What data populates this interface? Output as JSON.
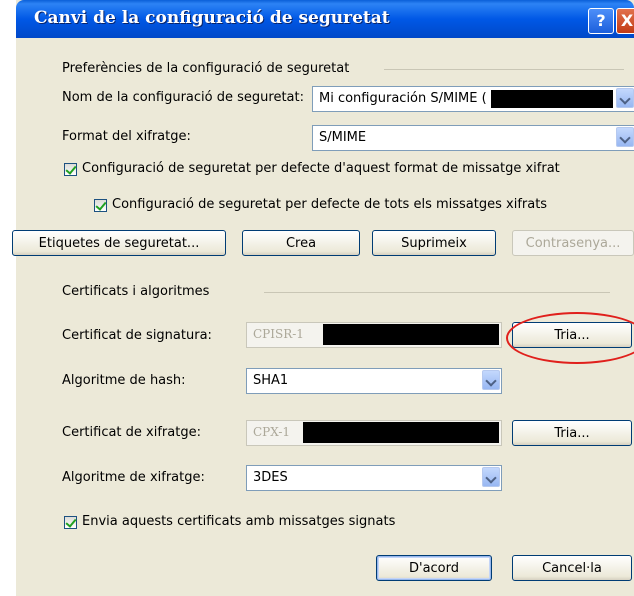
{
  "window": {
    "title": "Canvi de la configuració de seguretat",
    "help_label": "?",
    "close_label": "X"
  },
  "preferences": {
    "group_label": "Preferències de la configuració de seguretat",
    "name_label": "Nom de la configuració de seguretat:",
    "name_value": "Mi configuración S/MIME (",
    "format_label": "Format del xifratge:",
    "format_value": "S/MIME",
    "default_format_checkbox": {
      "label": "Configuració de seguretat per defecte d'aquest format de missatge xifrat",
      "checked": true
    },
    "default_all_checkbox": {
      "label": "Configuració de seguretat per defecte de tots els missatges xifrats",
      "checked": true
    }
  },
  "buttons": {
    "labels": "Etiquetes de seguretat...",
    "create": "Crea",
    "delete": "Suprimeix",
    "password": "Contrasenya..."
  },
  "certificates": {
    "group_label": "Certificats i algoritmes",
    "signing_label": "Certificat de signatura:",
    "signing_value": "CPISR-1",
    "signing_choose": "Tria...",
    "hash_label": "Algoritme de hash:",
    "hash_value": "SHA1",
    "encryption_label": "Certificat de xifratge:",
    "encryption_value": "CPX-1",
    "encryption_choose": "Tria...",
    "encryption_alg_label": "Algoritme de xifratge:",
    "encryption_alg_value": "3DES",
    "send_certs_checkbox": {
      "label": "Envia aquests certificats amb missatges signats",
      "checked": true
    }
  },
  "footer": {
    "ok": "D'acord",
    "cancel": "Cancel·la"
  },
  "colors": {
    "titlebar": "#0058e6",
    "dialog_bg": "#ece9d8",
    "highlight": "#e0201c"
  }
}
